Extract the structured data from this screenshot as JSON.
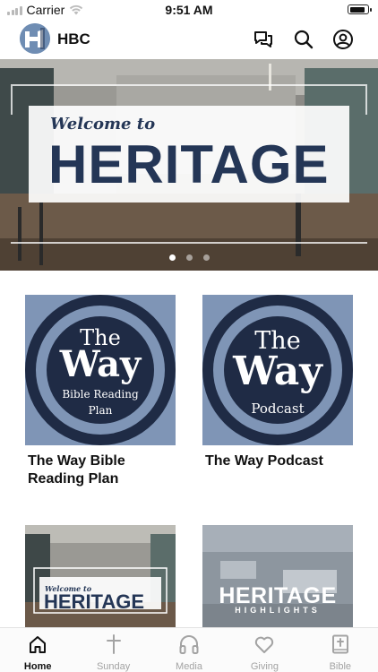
{
  "status_bar": {
    "carrier": "Carrier",
    "time": "9:51 AM"
  },
  "header": {
    "title": "HBC",
    "logo_letter": "H"
  },
  "hero": {
    "welcome": "Welcome to",
    "headline": "HERITAGE",
    "carousel_pages": 3,
    "active_page": 1
  },
  "cards": [
    {
      "title": "The Way Bible Reading Plan",
      "art": {
        "line1": "The",
        "line2": "Way",
        "line3": "Bible Reading",
        "line4": "Plan"
      }
    },
    {
      "title": "The Way Podcast",
      "art": {
        "line1": "The",
        "line2": "Way",
        "line3": "Podcast"
      }
    },
    {
      "title": "",
      "art": {
        "welcome": "Welcome to",
        "headline": "HERITAGE"
      }
    },
    {
      "title": "",
      "art": {
        "headline": "HERITAGE",
        "sub": "HIGHLIGHTS"
      }
    }
  ],
  "tabs": [
    {
      "label": "Home",
      "icon": "home-icon",
      "active": true
    },
    {
      "label": "Sunday",
      "icon": "cross-icon",
      "active": false
    },
    {
      "label": "Media",
      "icon": "headphones-icon",
      "active": false
    },
    {
      "label": "Giving",
      "icon": "heart-icon",
      "active": false
    },
    {
      "label": "Bible",
      "icon": "bible-icon",
      "active": false
    }
  ],
  "colors": {
    "navy": "#1f2b45",
    "ring": "#7f95b6",
    "heritage_blue": "#243656",
    "tab_inactive": "#a3a3a3"
  }
}
